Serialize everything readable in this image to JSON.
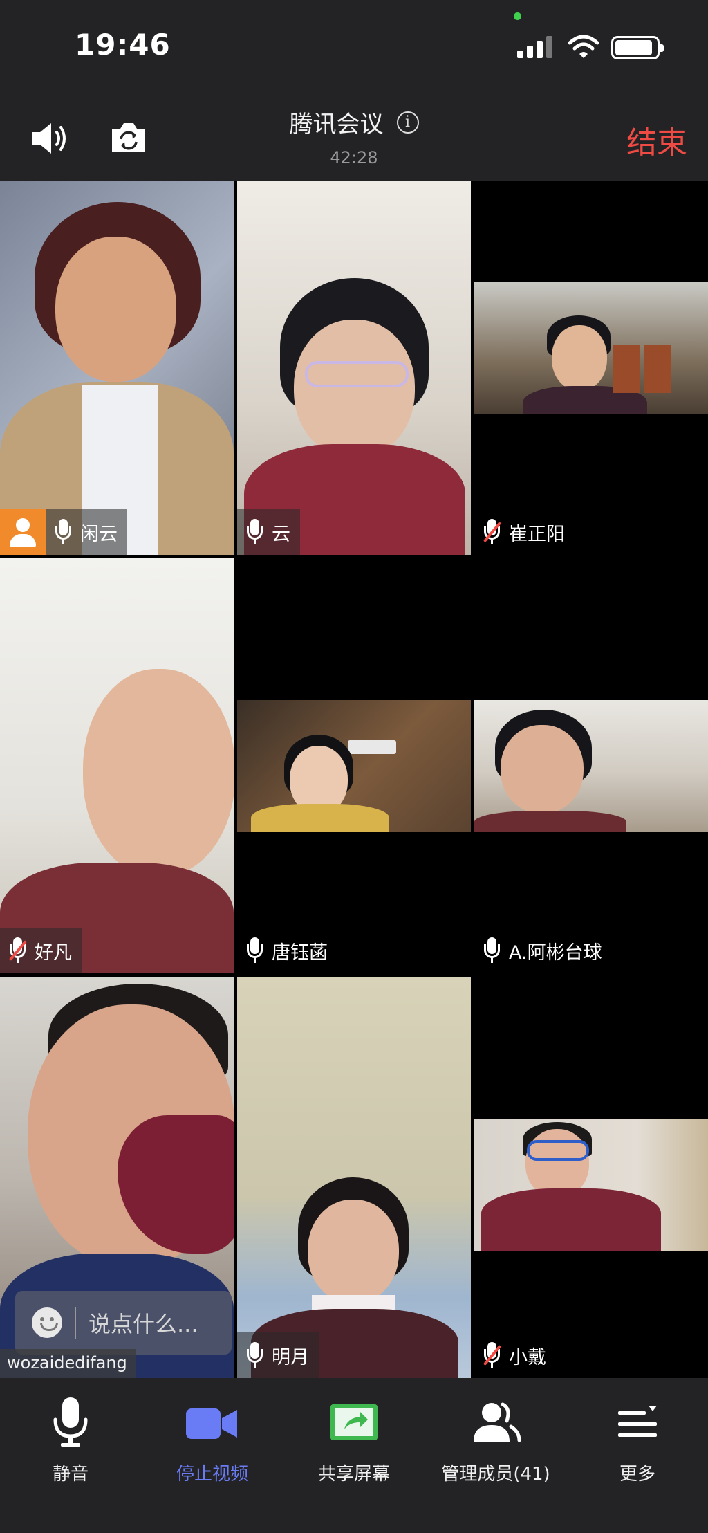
{
  "status_bar": {
    "time": "19:46"
  },
  "header": {
    "title": "腾讯会议",
    "duration": "42:28",
    "end_label": "结束"
  },
  "participants": [
    {
      "name": "闲云",
      "mic": "on",
      "host": true
    },
    {
      "name": "云",
      "mic": "on",
      "host": false
    },
    {
      "name": "崔正阳",
      "mic": "muted",
      "host": false
    },
    {
      "name": "好凡",
      "mic": "muted",
      "host": false
    },
    {
      "name": "唐钰菡",
      "mic": "on",
      "host": false
    },
    {
      "name": "A.阿彬台球",
      "mic": "on",
      "host": false
    },
    {
      "name": "wozaidedifang",
      "mic": "",
      "host": false
    },
    {
      "name": "明月",
      "mic": "on",
      "host": false
    },
    {
      "name": "小戴",
      "mic": "muted",
      "host": false
    }
  ],
  "chat": {
    "placeholder": "说点什么..."
  },
  "toolbar": {
    "mute_label": "静音",
    "stop_video_label": "停止视频",
    "share_screen_label": "共享屏幕",
    "manage_members_label": "管理成员(41)",
    "more_label": "更多"
  },
  "colors": {
    "end": "#ef4a43",
    "active": "#6a7cf5",
    "host_badge": "#f08a2a",
    "bar_background": "#232325"
  }
}
